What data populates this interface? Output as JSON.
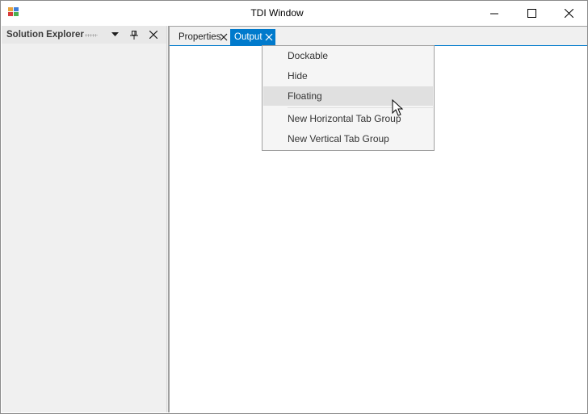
{
  "window": {
    "title": "TDI Window"
  },
  "caption_buttons": {
    "minimize": "minimize-icon",
    "maximize": "maximize-icon",
    "close": "close-icon"
  },
  "left_panel": {
    "title": "Solution Explorer",
    "buttons": [
      "dropdown-arrow-icon",
      "pin-icon",
      "close-icon"
    ]
  },
  "tabs": [
    {
      "label": "Properties",
      "active": false
    },
    {
      "label": "Output",
      "active": true
    }
  ],
  "context_menu": {
    "items": [
      {
        "label": "Dockable",
        "hover": false
      },
      {
        "label": "Hide",
        "hover": false
      },
      {
        "label": "Floating",
        "hover": true
      },
      {
        "label": "New Horizontal Tab Group",
        "hover": false
      },
      {
        "label": "New Vertical Tab Group",
        "hover": false
      }
    ]
  },
  "colors": {
    "accent": "#007acc",
    "panel": "#f0f0f0",
    "menu_hover": "#e0e0e0"
  }
}
